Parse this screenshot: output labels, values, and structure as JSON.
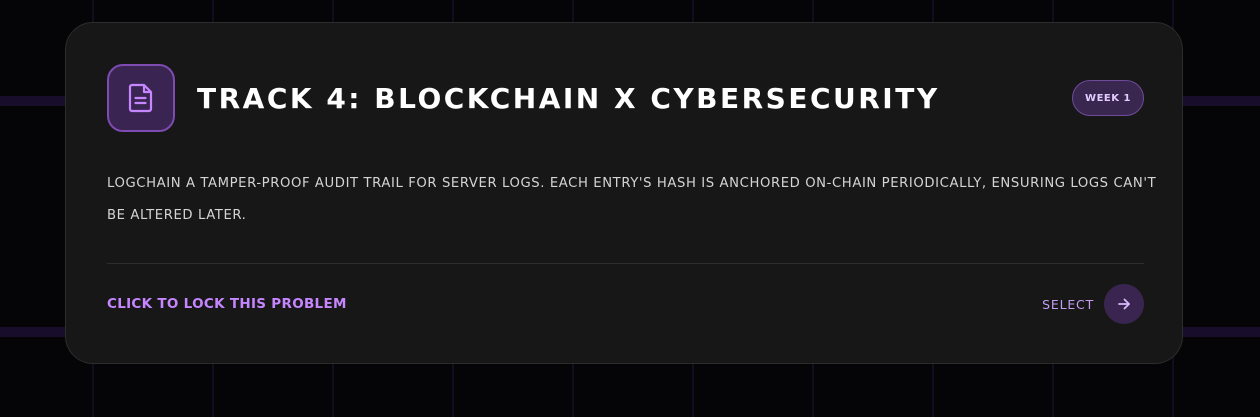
{
  "card": {
    "icon": "document-icon",
    "title": "Track 4: Blockchain x Cybersecurity",
    "badge": "Week 1",
    "description": "LogChain a tamper-proof audit trail for server logs. Each entry's hash is anchored on-chain periodically, ensuring logs can't be altered later.",
    "cta": "Click to lock this problem",
    "select_label": "Select",
    "select_icon": "arrow-right-icon"
  },
  "colors": {
    "accent": "#c686ff",
    "card_bg": "#171717",
    "page_bg": "#050407",
    "icon_bg": "#3a2452"
  }
}
